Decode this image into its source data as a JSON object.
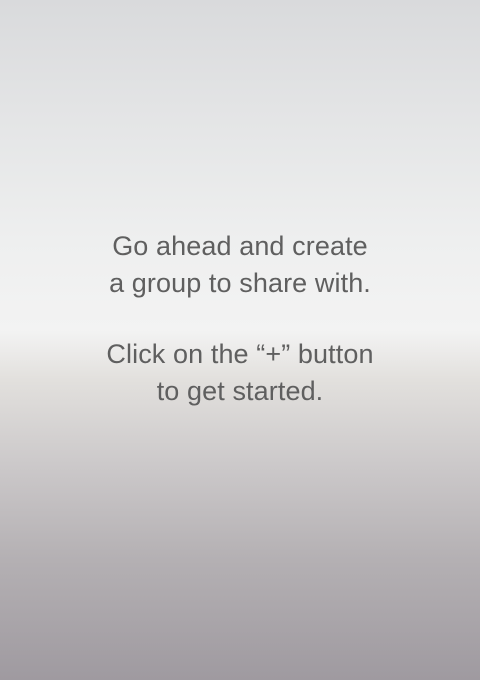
{
  "empty_state": {
    "paragraph1": {
      "line1": "Go ahead and create",
      "line2": "a group to share with."
    },
    "paragraph2": {
      "line1": "Click on the “+” button",
      "line2": "to get started."
    }
  }
}
